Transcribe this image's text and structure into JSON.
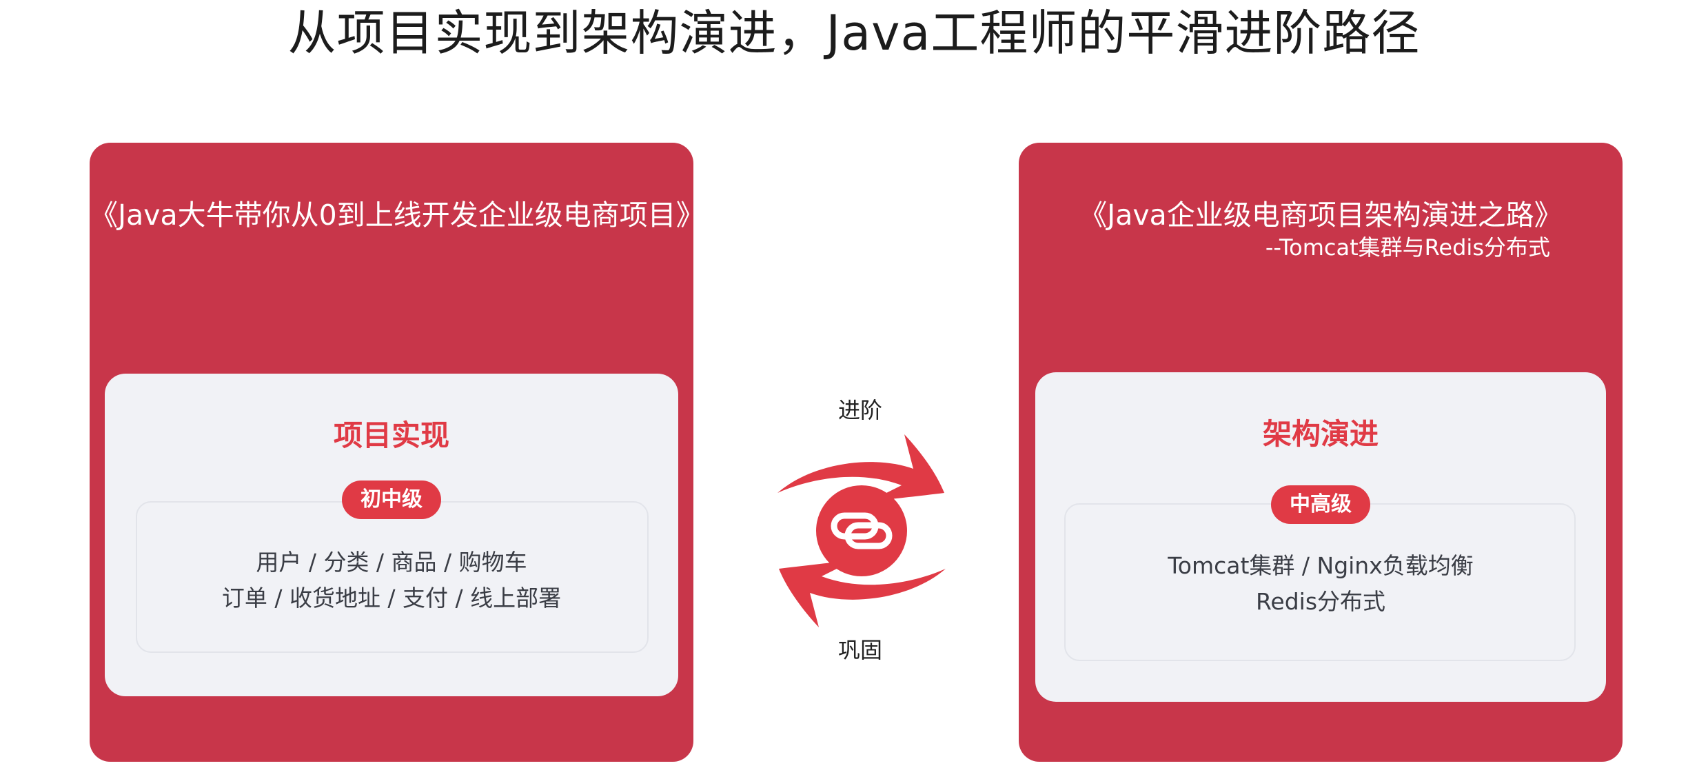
{
  "page_title": "从项目实现到架构演进，Java工程师的平滑进阶路径",
  "colors": {
    "card_red": "#c8364a",
    "accent_red": "#e03a45",
    "inner_bg": "#f1f2f6"
  },
  "left_course": {
    "title": "《Java大牛带你从0到上线开发企业级电商项目》",
    "heading": "项目实现",
    "level": "初中级",
    "topics_line1": "用户  /  分类  /  商品  /  购物车",
    "topics_line2": "订单  /  收货地址  /  支付  /  线上部署"
  },
  "right_course": {
    "title": "《Java企业级电商项目架构演进之路》",
    "subtitle": "--Tomcat集群与Redis分布式",
    "heading": "架构演进",
    "level": "中高级",
    "topics_line1": "Tomcat集群  /  Nginx负载均衡",
    "topics_line2": "Redis分布式"
  },
  "cycle": {
    "top_label": "进阶",
    "bottom_label": "巩固",
    "icon": "chain-link-icon"
  }
}
